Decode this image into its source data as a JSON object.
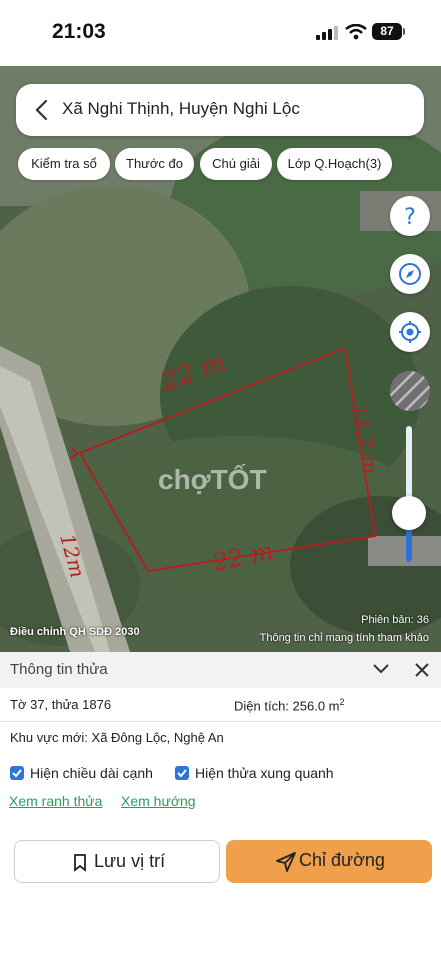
{
  "status_bar": {
    "time": "21:03",
    "battery": "87"
  },
  "search": {
    "location": "Xã Nghi Thịnh, Huyện Nghi Lộc"
  },
  "chips": [
    "Kiểm tra sổ",
    "Thước đo",
    "Chú giải",
    "Lớp Q.Hoạch(3)"
  ],
  "map": {
    "watermark": "chợTỐT",
    "version": "Phiên bản: 36",
    "adjust_label": "Điều chỉnh QH SDĐ 2030",
    "disclaimer": "Thông tin chỉ mang tính tham khảo",
    "annotations": {
      "top": "22 m",
      "right": "11,7 m",
      "left": "12m",
      "bottom": "22 m"
    },
    "zoom_slider_level": 0.3
  },
  "panel": {
    "title": "Thông tin thửa",
    "sheet_parcel": "Tờ 37, thửa 1876",
    "area_label": "Diện tích: 256.0 m",
    "area_unit_sup": "2",
    "new_area": "Khu vực mới: Xã Đông Lộc, Nghệ An",
    "check_edges": "Hiện chiều dài cạnh",
    "check_neighbors": "Hiện thửa xung quanh",
    "link_boundary": "Xem ranh thửa",
    "link_direction": "Xem hướng",
    "save_label": "Lưu vị trí",
    "directions_label": "Chỉ đường"
  },
  "colors": {
    "accent_orange": "#f0a04b",
    "link_green": "#2a9d5c",
    "check_blue": "#2f74d6"
  },
  "icons": [
    "back-icon",
    "help-icon",
    "compass-icon",
    "locate-icon",
    "chevron-down-icon",
    "close-icon",
    "bookmark-icon",
    "send-icon"
  ]
}
